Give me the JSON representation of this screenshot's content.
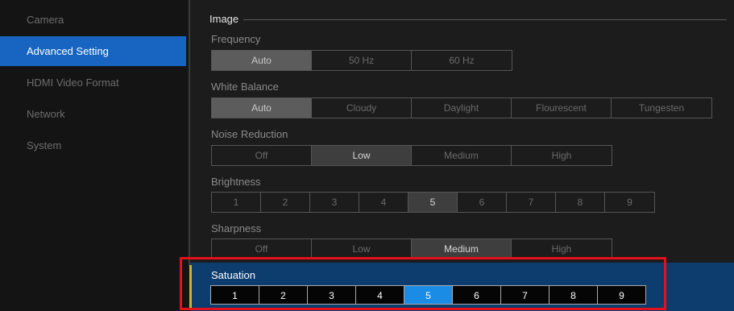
{
  "sidebar": {
    "items": [
      {
        "label": "Camera",
        "active": false
      },
      {
        "label": "Advanced Setting",
        "active": true
      },
      {
        "label": "HDMI Video Format",
        "active": false
      },
      {
        "label": "Network",
        "active": false
      },
      {
        "label": "System",
        "active": false
      }
    ]
  },
  "section": {
    "title": "Image"
  },
  "frequency": {
    "label": "Frequency",
    "options": [
      "Auto",
      "50 Hz",
      "60 Hz"
    ],
    "selected": "Auto"
  },
  "white_balance": {
    "label": "White Balance",
    "options": [
      "Auto",
      "Cloudy",
      "Daylight",
      "Flourescent",
      "Tungesten"
    ],
    "selected": "Auto"
  },
  "noise_reduction": {
    "label": "Noise Reduction",
    "options": [
      "Off",
      "Low",
      "Medium",
      "High"
    ],
    "selected": "Low"
  },
  "brightness": {
    "label": "Brightness",
    "options": [
      "1",
      "2",
      "3",
      "4",
      "5",
      "6",
      "7",
      "8",
      "9"
    ],
    "selected": "5"
  },
  "sharpness": {
    "label": "Sharpness",
    "options": [
      "Off",
      "Low",
      "Medium",
      "High"
    ],
    "selected": "Medium"
  },
  "saturation": {
    "label": "Satuation",
    "options": [
      "1",
      "2",
      "3",
      "4",
      "5",
      "6",
      "7",
      "8",
      "9"
    ],
    "selected": "5"
  },
  "colors": {
    "accent_blue": "#1765c0",
    "focus_row": "#0d3d6f",
    "selected_blue": "#1b8ce6",
    "highlight_red": "#e3111b"
  }
}
